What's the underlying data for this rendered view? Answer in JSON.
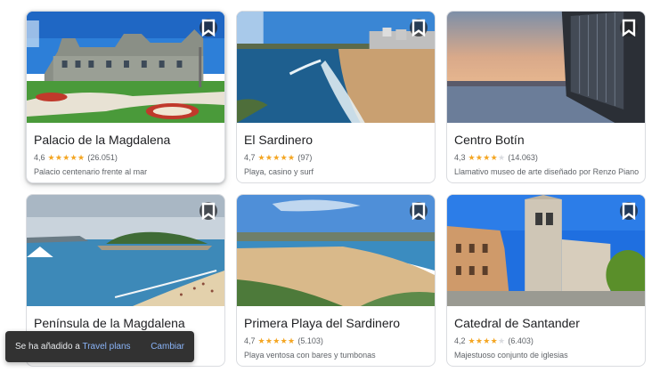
{
  "places": [
    {
      "name": "Palacio de la Magdalena",
      "rating": "4,6",
      "stars": 5,
      "reviews": "(26.051)",
      "description": "Palacio centenario frente al mar"
    },
    {
      "name": "El Sardinero",
      "rating": "4,7",
      "stars": 5,
      "reviews": "(97)",
      "description": "Playa, casino y surf"
    },
    {
      "name": "Centro Botín",
      "rating": "4,3",
      "stars": 4,
      "reviews": "(14.063)",
      "description": "Llamativo museo de arte diseñado por Renzo Piano"
    },
    {
      "name": "Península de la Magdalena",
      "rating": "",
      "stars": 0,
      "reviews": "",
      "description": ""
    },
    {
      "name": "Primera Playa del Sardinero",
      "rating": "4,7",
      "stars": 5,
      "reviews": "(5.103)",
      "description": "Playa ventosa con bares y tumbonas"
    },
    {
      "name": "Catedral de Santander",
      "rating": "4,2",
      "stars": 4,
      "reviews": "(6.403)",
      "description": "Majestuoso conjunto de iglesias"
    }
  ],
  "toast": {
    "prefix": "Se ha añadido a ",
    "link": "Travel plans",
    "action": "Cambiar"
  },
  "icons": {
    "save": "bookmark-icon",
    "star": "star-icon"
  },
  "colors": {
    "star": "#f4a623",
    "link": "#8ab4f8",
    "toast_bg": "#323232"
  }
}
